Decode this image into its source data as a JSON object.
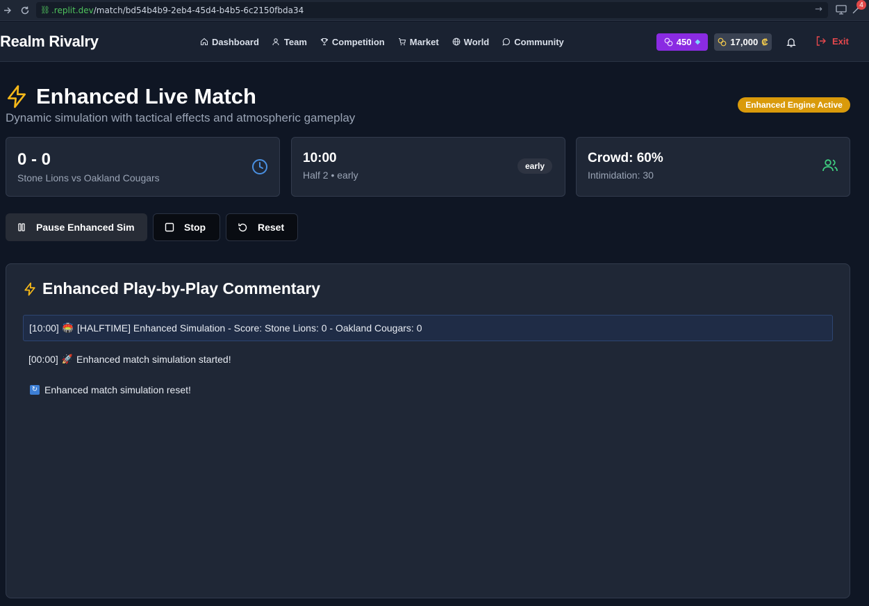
{
  "browser": {
    "url_domain": ".replit.dev",
    "url_path": "/match/bd54b4b9-2eb4-45d4-b4b5-6c2150fbda34",
    "notification_count": "4"
  },
  "header": {
    "logo": "Realm Rivalry",
    "nav": [
      {
        "label": "Dashboard",
        "icon": "home-icon"
      },
      {
        "label": "Team",
        "icon": "users-icon"
      },
      {
        "label": "Competition",
        "icon": "trophy-icon"
      },
      {
        "label": "Market",
        "icon": "cart-icon"
      },
      {
        "label": "World",
        "icon": "globe-icon"
      },
      {
        "label": "Community",
        "icon": "chat-icon"
      }
    ],
    "gems": "450",
    "coins": "17,000",
    "coin_symbol": "₡",
    "exit_label": "Exit"
  },
  "page": {
    "title": "Enhanced Live Match",
    "subtitle": "Dynamic simulation with tactical effects and atmospheric gameplay",
    "engine_badge": "Enhanced Engine Active"
  },
  "cards": {
    "score": "0 - 0",
    "matchup": "Stone Lions vs Oakland Cougars",
    "clock": "10:00",
    "half_info": "Half 2 • early",
    "phase_badge": "early",
    "crowd": "Crowd: 60%",
    "intimidation": "Intimidation: 30"
  },
  "controls": {
    "pause_label": "Pause Enhanced Sim",
    "stop_label": "Stop",
    "reset_label": "Reset"
  },
  "commentary": {
    "title": "Enhanced Play-by-Play Commentary",
    "entries": [
      {
        "time": "[10:00]",
        "emoji": "🏟️",
        "text": "[HALFTIME] Enhanced Simulation - Score: Stone Lions: 0 - Oakland Cougars: 0"
      },
      {
        "time": "[00:00]",
        "emoji": "🚀",
        "text": "Enhanced match simulation started!"
      },
      {
        "time": "",
        "emoji": "🔄",
        "text": "Enhanced match simulation reset!"
      }
    ]
  },
  "colors": {
    "accent_yellow": "#f5b819",
    "gem_purple": "#8a2be2",
    "exit_red": "#e5484d",
    "clock_blue": "#4a90e2",
    "crowd_green": "#3fcf80"
  }
}
